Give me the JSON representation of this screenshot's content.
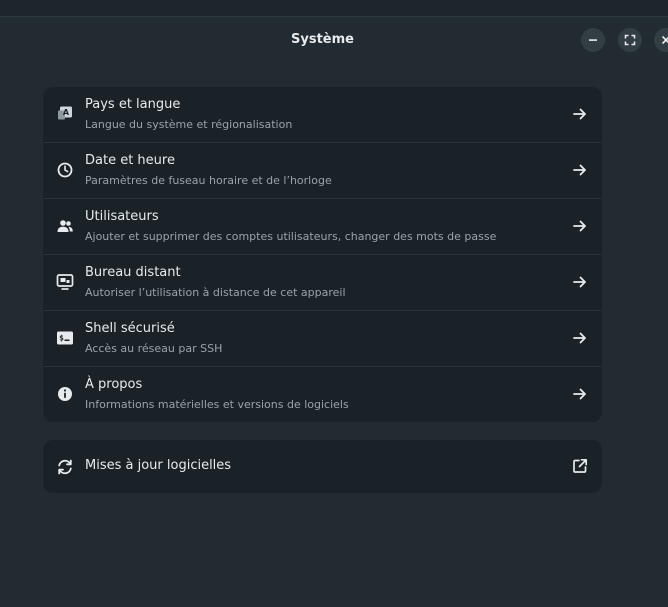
{
  "window": {
    "title": "Système"
  },
  "settings": {
    "items": [
      {
        "title": "Pays et langue",
        "subtitle": "Langue du système et régionalisation",
        "icon": "language-icon"
      },
      {
        "title": "Date et heure",
        "subtitle": "Paramètres de fuseau horaire et de l’horloge",
        "icon": "clock-icon"
      },
      {
        "title": "Utilisateurs",
        "subtitle": "Ajouter et supprimer des comptes utilisateurs, changer des mots de passe",
        "icon": "users-icon"
      },
      {
        "title": "Bureau distant",
        "subtitle": "Autoriser l’utilisation à distance de cet appareil",
        "icon": "remote-desktop-icon"
      },
      {
        "title": "Shell sécurisé",
        "subtitle": "Accès au réseau par SSH",
        "icon": "terminal-icon"
      },
      {
        "title": "À propos",
        "subtitle": "Informations matérielles et versions de logiciels",
        "icon": "info-icon"
      }
    ]
  },
  "updates": {
    "title": "Mises à jour logicielles",
    "icon": "refresh-icon"
  },
  "colors": {
    "background": "#222b31",
    "card": "#1a2227",
    "text": "#e8eaed",
    "subtext": "#9aa3aa"
  }
}
